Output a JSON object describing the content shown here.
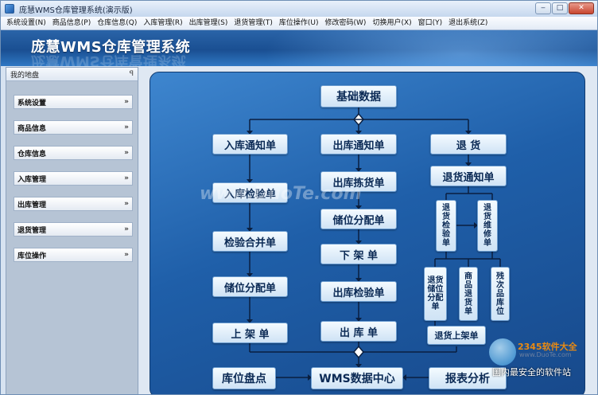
{
  "window": {
    "title": "庞慧WMS仓库管理系统(演示版)",
    "minimize": "‒",
    "maximize": "□",
    "close": "✕"
  },
  "menu": [
    "系统设置(N)",
    "商品信息(P)",
    "仓库信息(Q)",
    "入库管理(R)",
    "出库管理(S)",
    "退货管理(T)",
    "库位操作(U)",
    "修改密码(W)",
    "切换用户(X)",
    "窗口(Y)",
    "退出系统(Z)"
  ],
  "banner": {
    "title": "庞慧WMS仓库管理系统"
  },
  "sidebar": {
    "title": "我的地盘",
    "pin": "ꟼ",
    "chevron": "»",
    "items": [
      "系统设置",
      "商品信息",
      "仓库信息",
      "入库管理",
      "出库管理",
      "退货管理",
      "库位操作"
    ]
  },
  "flow": {
    "top": "基础数据",
    "in": [
      "入库通知单",
      "入库检验单",
      "检验合并单",
      "储位分配单",
      "上 架 单"
    ],
    "out": [
      "出库通知单",
      "出库拣货单",
      "储位分配单",
      "下 架 单",
      "出库检验单",
      "出 库 单"
    ],
    "ret": {
      "head": "退 货",
      "notice": "退货通知单",
      "check": "退货检验单",
      "repair": "退货维修单",
      "alloc": "退货储位分配单",
      "product": "商品退货单",
      "defect": "残次品库位",
      "shelf": "退货上架单"
    },
    "bottom": {
      "stock": "库位盘点",
      "center": "WMS数据中心",
      "report": "报表分析"
    }
  },
  "watermarks": {
    "site": "www.DuoTe.com",
    "brand": "2345软件大全",
    "brand_url": "www.DuoTe.com",
    "slogan": "国内最安全的软件站"
  }
}
